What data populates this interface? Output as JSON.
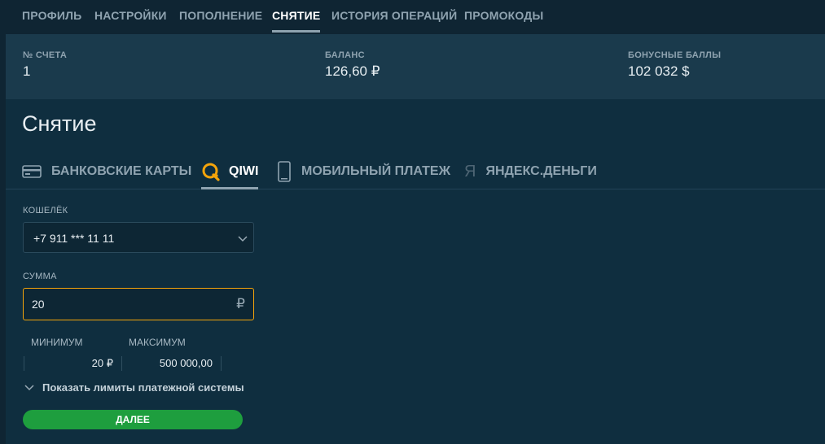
{
  "nav": {
    "tabs": [
      {
        "label": "ПРОФИЛЬ"
      },
      {
        "label": "НАСТРОЙКИ"
      },
      {
        "label": "ПОПОЛНЕНИЕ"
      },
      {
        "label": "СНЯТИЕ",
        "active": true
      },
      {
        "label": "ИСТОРИЯ ОПЕРАЦИЙ"
      },
      {
        "label": "ПРОМОКОДЫ"
      }
    ]
  },
  "account": {
    "number_label": "№ СЧЕТА",
    "number_value": "1",
    "balance_label": "БАЛАНС",
    "balance_value": "126,60 ₽",
    "bonus_label": "БОНУСНЫЕ БАЛЛЫ",
    "bonus_value": "102 032 $"
  },
  "page_title": "Снятие",
  "methods": [
    {
      "label": "БАНКОВСКИЕ КАРТЫ",
      "icon": "card-icon"
    },
    {
      "label": "QIWI",
      "icon": "qiwi-icon",
      "active": true
    },
    {
      "label": "МОБИЛЬНЫЙ ПЛАТЕЖ",
      "icon": "phone-icon"
    },
    {
      "label": "ЯНДЕКС.ДЕНЬГИ",
      "icon": "yandex-icon"
    }
  ],
  "form": {
    "wallet_label": "КОШЕЛЁК",
    "wallet_value": "+7 911 *** 11 11",
    "amount_label": "СУММА",
    "amount_value": "20",
    "currency_symbol": "₽",
    "min_label": "МИНИМУМ",
    "min_value": "20 ₽",
    "max_label": "МАКСИМУМ",
    "max_value": "500 000,00",
    "show_limits": "Показать лимиты платежной системы",
    "submit": "ДАЛЕЕ"
  },
  "colors": {
    "background": "#0f2533",
    "accent_orange": "#f4a40b",
    "button_green": "#1e9e3e"
  }
}
